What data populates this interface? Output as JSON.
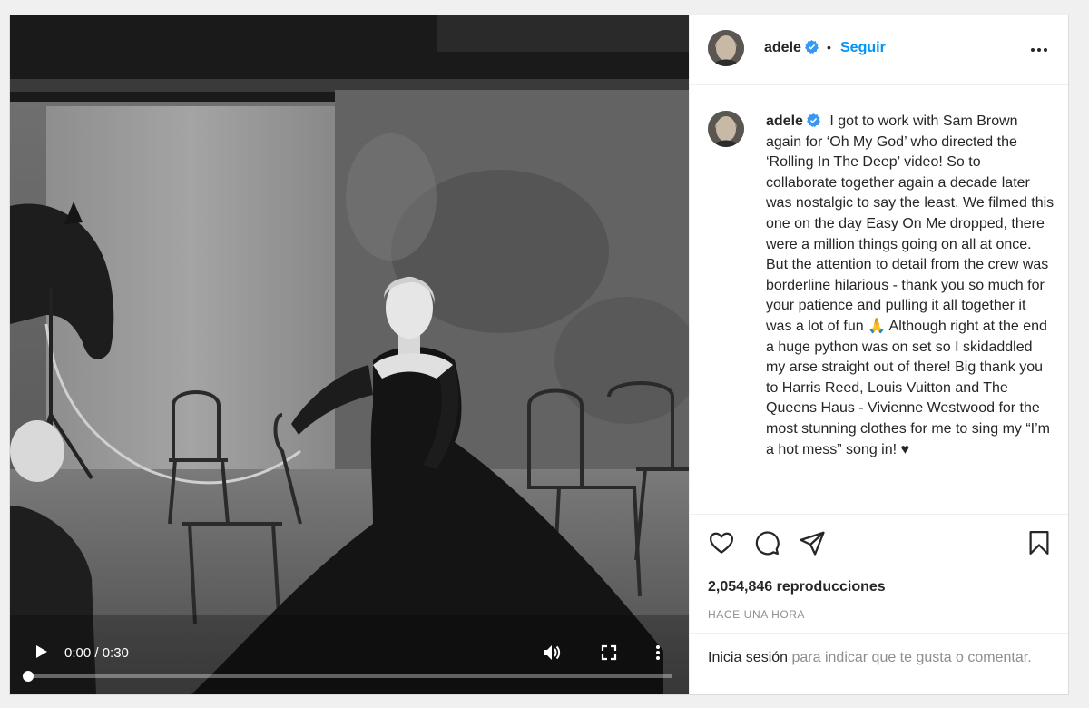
{
  "post": {
    "username": "adele",
    "follow_label": "Seguir",
    "dot": "•",
    "caption": "I got to work with Sam Brown again for ‘Oh My God’ who directed the ‘Rolling In The Deep’ video! So to collaborate together again a decade later was nostalgic to say the least. We filmed this one on the day Easy On Me dropped, there were a million things going on all at once. But the attention to detail from the crew was borderline hilarious - thank you so much for your patience and pulling it all together it was a lot of fun 🙏 Although right at the end a huge python was on set so I skidaddled my arse straight out of there! Big thank you to Harris Reed, Louis Vuitton and The Queens Haus - Vivienne Westwood for the most stunning clothes for me to sing my “I’m a hot mess” song in! ♥",
    "views_count": "2,054,846",
    "views_label": "reproducciones",
    "time_ago": "HACE UNA HORA"
  },
  "video": {
    "time_display": "0:00 / 0:30",
    "progress": 0
  },
  "login_prompt": {
    "link": "Inicia sesión",
    "rest": " para indicar que te gusta o comentar."
  },
  "icons": {
    "verified": "verified-badge-icon",
    "options": "more-horizontal-icon",
    "like": "heart-icon",
    "comment": "comment-bubble-icon",
    "share": "paper-plane-icon",
    "save": "bookmark-icon",
    "play": "play-icon",
    "volume": "volume-icon",
    "fullscreen": "fullscreen-icon",
    "video_menu": "more-vertical-icon"
  },
  "colors": {
    "accent": "#0095f6",
    "text": "#262626",
    "muted": "#8e8e8e"
  }
}
